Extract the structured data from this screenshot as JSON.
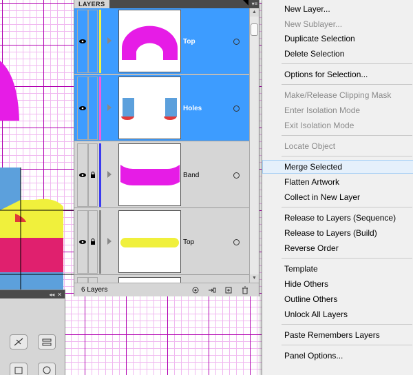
{
  "layers_panel": {
    "tab_label": "LAYERS",
    "layer_count_label": "6 Layers",
    "layers": [
      {
        "name": "Top",
        "selected": true,
        "color": "#f5f542",
        "locked": false
      },
      {
        "name": "Holes",
        "selected": true,
        "color": "#f55ce0",
        "locked": false
      },
      {
        "name": "Band",
        "selected": false,
        "color": "#3a3af0",
        "locked": true
      },
      {
        "name": "Top",
        "selected": false,
        "color": "#888888",
        "locked": true
      }
    ],
    "footer_icons": [
      "make-clipping-mask-icon",
      "create-sublayer-icon",
      "new-layer-icon",
      "delete-layer-icon"
    ]
  },
  "context_menu": {
    "items": [
      {
        "label": "New Layer...",
        "enabled": true
      },
      {
        "label": "New Sublayer...",
        "enabled": false
      },
      {
        "label": "Duplicate Selection",
        "enabled": true
      },
      {
        "label": "Delete Selection",
        "enabled": true
      },
      {
        "label": "Options for Selection...",
        "enabled": true
      },
      {
        "label": "Make/Release Clipping Mask",
        "enabled": false
      },
      {
        "label": "Enter Isolation Mode",
        "enabled": false
      },
      {
        "label": "Exit Isolation Mode",
        "enabled": false
      },
      {
        "label": "Locate Object",
        "enabled": false
      },
      {
        "label": "Merge Selected",
        "enabled": true,
        "hover": true
      },
      {
        "label": "Flatten Artwork",
        "enabled": true
      },
      {
        "label": "Collect in New Layer",
        "enabled": true
      },
      {
        "label": "Release to Layers (Sequence)",
        "enabled": true
      },
      {
        "label": "Release to Layers (Build)",
        "enabled": true
      },
      {
        "label": "Reverse Order",
        "enabled": true
      },
      {
        "label": "Template",
        "enabled": true
      },
      {
        "label": "Hide Others",
        "enabled": true
      },
      {
        "label": "Outline Others",
        "enabled": true
      },
      {
        "label": "Unlock All Layers",
        "enabled": true
      },
      {
        "label": "Paste Remembers Layers",
        "enabled": true
      },
      {
        "label": "Panel Options...",
        "enabled": true
      }
    ]
  },
  "colors": {
    "selection_blue": "#3d9cff",
    "magenta": "#e61ce6",
    "yellow": "#f0f03c",
    "pink": "#e0206e",
    "light_blue": "#5ca0dc",
    "grid": "#b000b0"
  }
}
